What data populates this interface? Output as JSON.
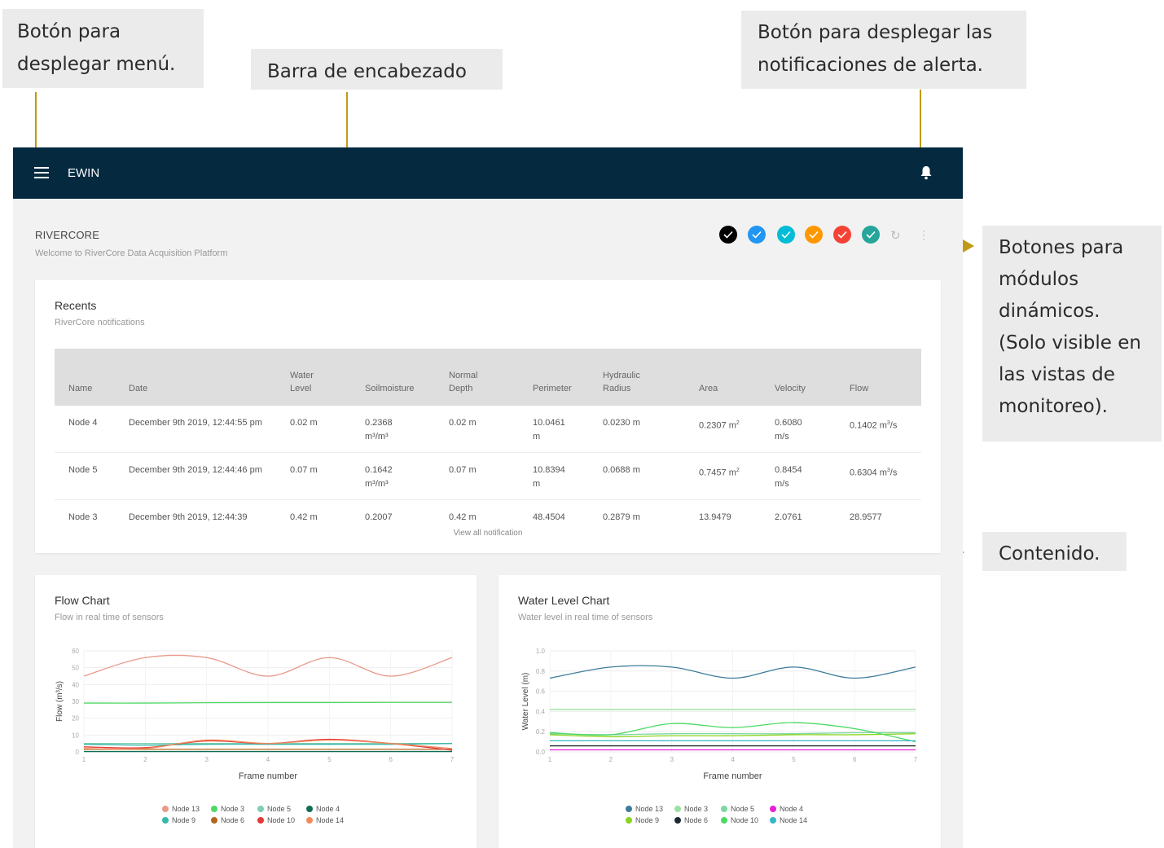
{
  "annotations": {
    "menu_button": "Botón para desplegar menú.",
    "header_bar": "Barra de encabezado",
    "alerts_button": "Botón para desplegar las notificaciones de alerta.",
    "modules": "Botones para módulos dinámicos. (Solo visible en las vistas de monitoreo).",
    "content": "Contenido."
  },
  "header": {
    "title": "EWIN"
  },
  "page": {
    "title": "RIVERCORE",
    "subtitle": "Welcome to RiverCore Data Acquisition Platform"
  },
  "modules": [
    {
      "color": "#000000",
      "icon": "check-icon"
    },
    {
      "color": "#2196f3",
      "icon": "check-icon"
    },
    {
      "color": "#00bcd4",
      "icon": "check-icon"
    },
    {
      "color": "#ff9800",
      "icon": "check-icon"
    },
    {
      "color": "#f44336",
      "icon": "check-icon"
    },
    {
      "color": "#26a69a",
      "icon": "check-icon"
    }
  ],
  "recents": {
    "title": "Recents",
    "subtitle": "RiverCore notifications",
    "columns": [
      "Name",
      "Date",
      "Water Level",
      "Soilmoisture",
      "Normal Depth",
      "Perimeter",
      "Hydraulic Radius",
      "Area",
      "Velocity",
      "Flow"
    ],
    "rows": [
      {
        "name": "Node 4",
        "date": "December 9th 2019, 12:44:55 pm",
        "water_level": "0.02 m",
        "soilmoisture": "0.2368 m³/m³",
        "normal_depth": "0.02 m",
        "perimeter": "10.0461 m",
        "hydraulic_radius": "0.0230 m",
        "area": "0.2307 m",
        "area_sup": "2",
        "velocity": "0.6080 m/s",
        "flow": "0.1402 m",
        "flow_sup": "3",
        "flow_unit": "/s"
      },
      {
        "name": "Node 5",
        "date": "December 9th 2019, 12:44:46 pm",
        "water_level": "0.07 m",
        "soilmoisture": "0.1642 m³/m³",
        "normal_depth": "0.07 m",
        "perimeter": "10.8394 m",
        "hydraulic_radius": "0.0688 m",
        "area": "0.7457 m",
        "area_sup": "2",
        "velocity": "0.8454 m/s",
        "flow": "0.6304 m",
        "flow_sup": "3",
        "flow_unit": "/s"
      },
      {
        "name": "Node 3",
        "date": "December 9th 2019, 12:44:39",
        "water_level": "0.42 m",
        "soilmoisture": "0.2007",
        "normal_depth": "0.42 m",
        "perimeter": "48.4504",
        "hydraulic_radius": "0.2879 m",
        "area": "13.9479",
        "area_sup": "",
        "velocity": "2.0761",
        "flow": "28.9577",
        "flow_sup": "",
        "flow_unit": ""
      }
    ],
    "view_all": "View all notification"
  },
  "chart_data": [
    {
      "type": "line",
      "title": "Flow Chart",
      "subtitle": "Flow in real time of sensors",
      "xlabel": "Frame number",
      "ylabel": "Flow (m³/s)",
      "x": [
        1,
        2,
        3,
        4,
        5,
        6,
        7
      ],
      "ylim": [
        0,
        60
      ],
      "yticks": [
        0,
        10,
        20,
        30,
        40,
        50,
        60
      ],
      "grid": true,
      "legend_position": "bottom",
      "series": [
        {
          "name": "Node 13",
          "color": "#e8998a",
          "values": [
            45,
            56,
            56,
            45,
            56,
            45,
            56
          ]
        },
        {
          "name": "Node 3",
          "color": "#4cd964",
          "values": [
            29,
            29,
            29.2,
            29.3,
            29.3,
            29.4,
            29.4
          ]
        },
        {
          "name": "Node 5",
          "color": "#7ecfb0",
          "values": [
            5,
            5,
            5,
            5,
            5,
            5,
            5
          ]
        },
        {
          "name": "Node 4",
          "color": "#0e6e55",
          "values": [
            0.2,
            0.2,
            0.2,
            0.2,
            0.2,
            0.2,
            0.2
          ]
        },
        {
          "name": "Node 9",
          "color": "#35b8a8",
          "values": [
            4.5,
            4,
            4.5,
            4.5,
            4.5,
            4.5,
            5
          ]
        },
        {
          "name": "Node 6",
          "color": "#b5651d",
          "values": [
            1.5,
            1.5,
            1.5,
            1.5,
            1.5,
            1.5,
            1.5
          ]
        },
        {
          "name": "Node 10",
          "color": "#e53935",
          "values": [
            3,
            2.5,
            6.5,
            5,
            7.5,
            5,
            1
          ]
        },
        {
          "name": "Node 14",
          "color": "#f08a5d",
          "values": [
            2,
            2,
            7,
            5,
            7,
            5,
            2
          ]
        }
      ]
    },
    {
      "type": "line",
      "title": "Water Level Chart",
      "subtitle": "Water level in real time of sensors",
      "xlabel": "Frame number",
      "ylabel": "Water Level (m)",
      "x": [
        1,
        2,
        3,
        4,
        5,
        6,
        7
      ],
      "ylim": [
        0,
        1.0
      ],
      "yticks": [
        0.0,
        0.2,
        0.4,
        0.6,
        0.8,
        1.0
      ],
      "grid": true,
      "legend_position": "bottom",
      "series": [
        {
          "name": "Node 13",
          "color": "#3e7c9b",
          "values": [
            0.73,
            0.84,
            0.84,
            0.73,
            0.84,
            0.73,
            0.84
          ]
        },
        {
          "name": "Node 3",
          "color": "#9be0a1",
          "values": [
            0.42,
            0.42,
            0.42,
            0.42,
            0.42,
            0.42,
            0.42
          ]
        },
        {
          "name": "Node 5",
          "color": "#7ed6a0",
          "values": [
            0.18,
            0.17,
            0.18,
            0.18,
            0.18,
            0.19,
            0.19
          ]
        },
        {
          "name": "Node 4",
          "color": "#e91ed6",
          "values": [
            0.02,
            0.02,
            0.02,
            0.02,
            0.02,
            0.02,
            0.02
          ]
        },
        {
          "name": "Node 9",
          "color": "#8bd420",
          "values": [
            0.17,
            0.15,
            0.16,
            0.16,
            0.17,
            0.17,
            0.18
          ]
        },
        {
          "name": "Node 6",
          "color": "#1e2a33",
          "values": [
            0.06,
            0.06,
            0.06,
            0.06,
            0.06,
            0.06,
            0.06
          ]
        },
        {
          "name": "Node 10",
          "color": "#4cd964",
          "values": [
            0.19,
            0.17,
            0.28,
            0.24,
            0.29,
            0.23,
            0.1
          ]
        },
        {
          "name": "Node 14",
          "color": "#35b8c8",
          "values": [
            0.11,
            0.11,
            0.11,
            0.11,
            0.11,
            0.11,
            0.11
          ]
        }
      ]
    }
  ]
}
